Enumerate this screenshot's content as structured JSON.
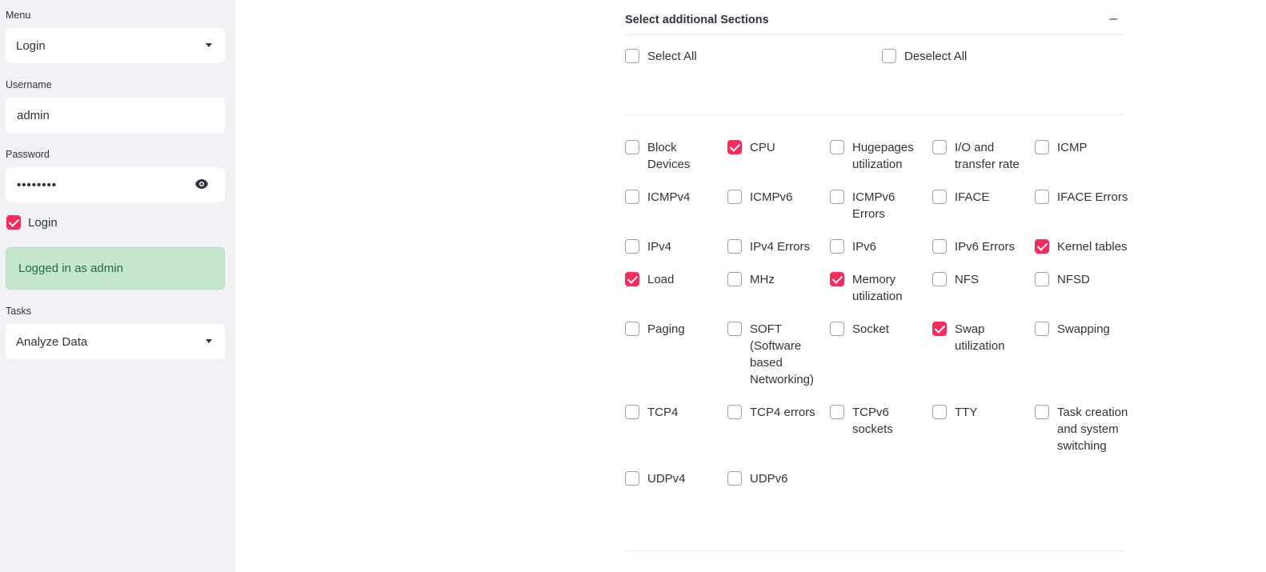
{
  "sidebar": {
    "menu": {
      "label": "Menu",
      "value": "Login"
    },
    "username": {
      "label": "Username",
      "value": "admin"
    },
    "password": {
      "label": "Password",
      "value": "••••••••"
    },
    "login_checkbox": {
      "label": "Login",
      "checked": true
    },
    "status_message": "Logged in as admin",
    "tasks": {
      "label": "Tasks",
      "value": "Analyze Data"
    }
  },
  "sections": {
    "title": "Select additional Sections",
    "collapse_symbol": "–",
    "select_all": "Select All",
    "deselect_all": "Deselect All",
    "items": [
      {
        "label": "Block Devices",
        "checked": false
      },
      {
        "label": "CPU",
        "checked": true
      },
      {
        "label": "Hugepages utilization",
        "checked": false
      },
      {
        "label": "I/O and transfer rate",
        "checked": false
      },
      {
        "label": "ICMP",
        "checked": false
      },
      {
        "label": "ICMPv4",
        "checked": false
      },
      {
        "label": "ICMPv6",
        "checked": false
      },
      {
        "label": "ICMPv6 Errors",
        "checked": false
      },
      {
        "label": "IFACE",
        "checked": false
      },
      {
        "label": "IFACE Errors",
        "checked": false
      },
      {
        "label": "IPv4",
        "checked": false
      },
      {
        "label": "IPv4 Errors",
        "checked": false
      },
      {
        "label": "IPv6",
        "checked": false
      },
      {
        "label": "IPv6 Errors",
        "checked": false
      },
      {
        "label": "Kernel tables",
        "checked": true
      },
      {
        "label": "Load",
        "checked": true
      },
      {
        "label": "MHz",
        "checked": false
      },
      {
        "label": "Memory utilization",
        "checked": true
      },
      {
        "label": "NFS",
        "checked": false
      },
      {
        "label": "NFSD",
        "checked": false
      },
      {
        "label": "Paging",
        "checked": false
      },
      {
        "label": "SOFT (Software based Networking)",
        "checked": false
      },
      {
        "label": "Socket",
        "checked": false
      },
      {
        "label": "Swap utilization",
        "checked": true
      },
      {
        "label": "Swapping",
        "checked": false
      },
      {
        "label": "TCP4",
        "checked": false
      },
      {
        "label": "TCP4 errors",
        "checked": false
      },
      {
        "label": "TCPv6 sockets",
        "checked": false
      },
      {
        "label": "TTY",
        "checked": false
      },
      {
        "label": "Task creation and system switching",
        "checked": false
      },
      {
        "label": "UDPv4",
        "checked": false
      },
      {
        "label": "UDPv6",
        "checked": false
      }
    ]
  },
  "colors": {
    "accent": "#ff2b5d",
    "sidebar_bg": "#f0f2f6",
    "success_bg": "#c5e6cf",
    "success_text": "#1f6e3a"
  }
}
